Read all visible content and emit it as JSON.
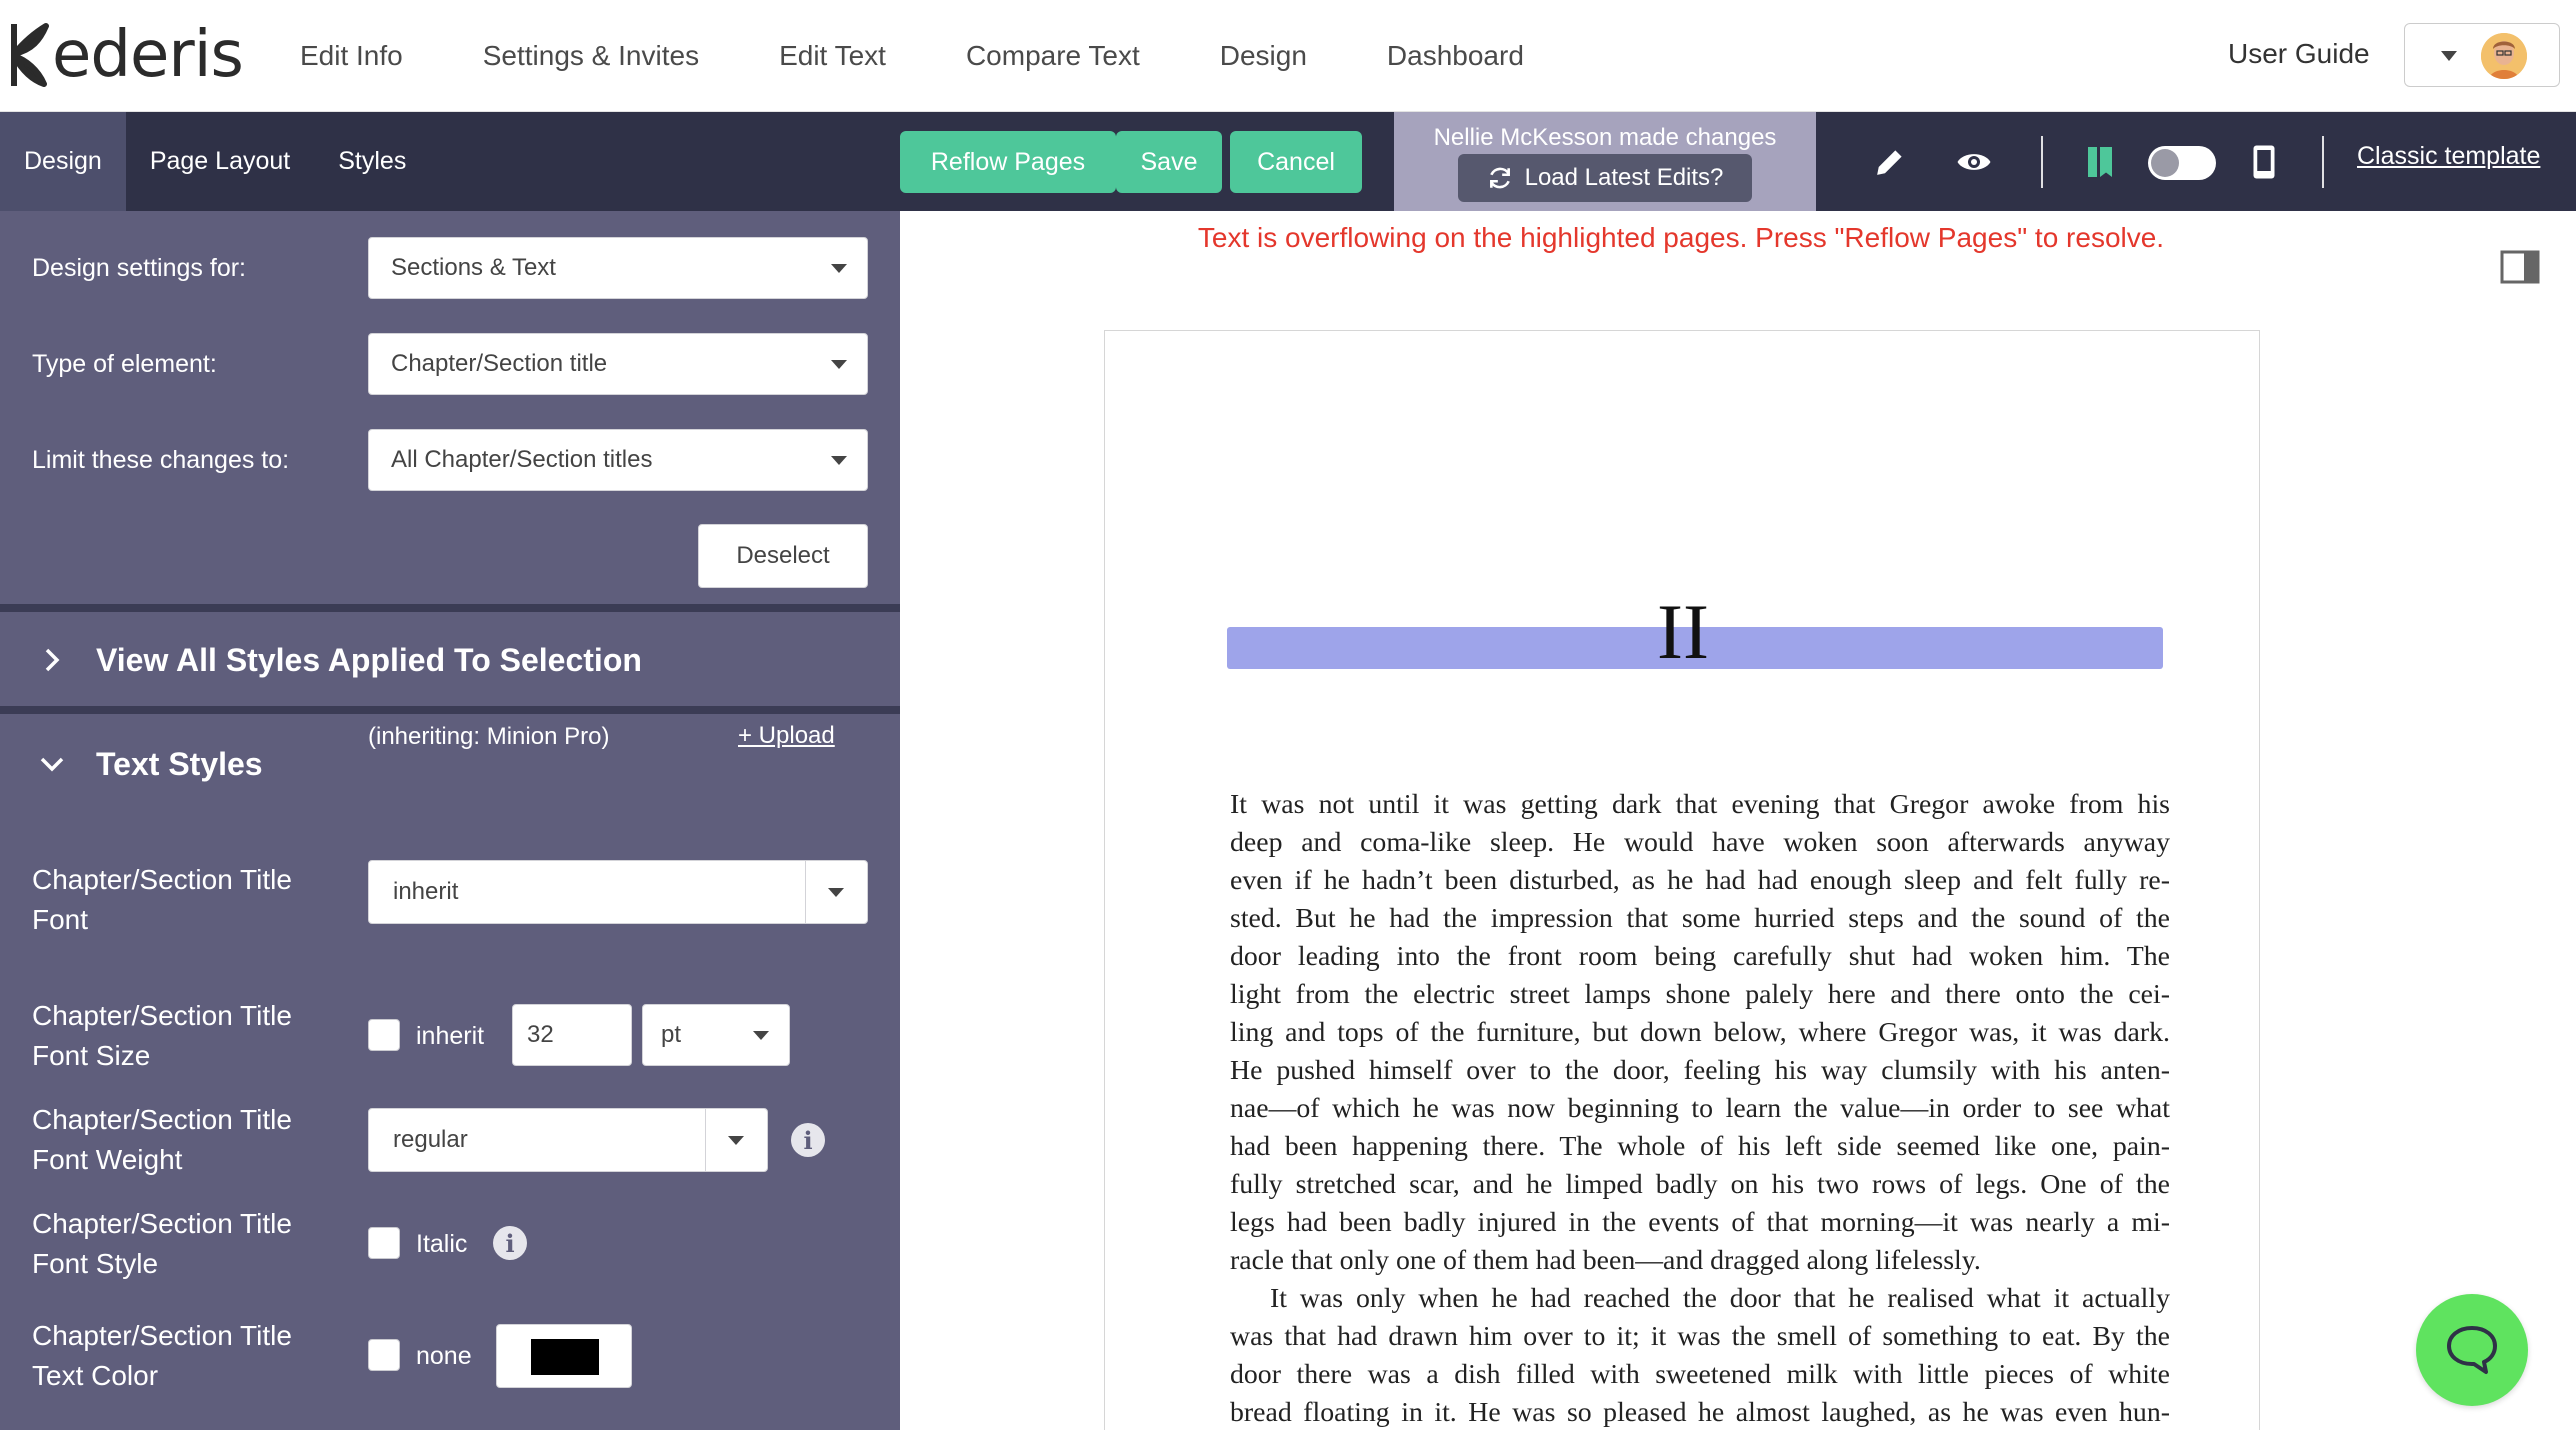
{
  "brand": {
    "name": "ederis"
  },
  "nav": {
    "links": [
      "Edit Info",
      "Settings & Invites",
      "Edit Text",
      "Compare Text",
      "Design",
      "Dashboard"
    ],
    "user_guide": "User Guide"
  },
  "toolbar": {
    "tabs": [
      "Design",
      "Page Layout",
      "Styles"
    ],
    "active_tab": "Design",
    "reflow_label": "Reflow Pages",
    "save_label": "Save",
    "cancel_label": "Cancel",
    "notice": "Nellie McKesson made changes",
    "load_edits_label": "Load Latest Edits?",
    "template_link": "Classic template",
    "accent_color": "#4ec79a",
    "bar_color": "#2f3147"
  },
  "panel": {
    "design_settings_label": "Design settings for:",
    "design_settings_value": "Sections & Text",
    "element_type_label": "Type of element:",
    "element_type_value": "Chapter/Section title",
    "limit_label": "Limit these changes to:",
    "limit_value": "All Chapter/Section titles",
    "deselect_label": "Deselect",
    "view_all_styles": "View All Styles Applied To Selection",
    "text_styles": "Text Styles",
    "font_label": "Chapter/Section Title Font",
    "font_value": "inherit",
    "font_hint": "(inheriting: Minion Pro)",
    "upload_label": "+ Upload",
    "size_label": "Chapter/Section Title Font Size",
    "size_inherit": "inherit",
    "size_value": "32",
    "size_unit": "pt",
    "weight_label": "Chapter/Section Title Font Weight",
    "weight_value": "regular",
    "style_label": "Chapter/Section Title Font Style",
    "style_italic": "Italic",
    "color_label": "Chapter/Section Title Text Color",
    "color_none": "none",
    "text_color": "#000000",
    "panel_color": "#5f5e7c"
  },
  "preview": {
    "overflow_message": "Text is overflowing on the highlighted pages. Press \"Reflow Pages\" to resolve.",
    "chapter_title": "II",
    "highlight_color": "#9ea4ea",
    "lines": [
      "It was not until it was getting dark that evening that Gregor awoke from his",
      "deep and coma-like sleep. He would have woken soon afterwards anyway",
      "even if he hadn’t been disturbed, as he had had enough sleep and felt fully re-",
      "sted. But he had the impression that some hurried steps and the sound of the",
      "door leading into the front room being carefully shut had woken him. The",
      "light from the electric street lamps shone palely here and there onto the cei-",
      "ling and tops of the furniture, but down below, where Gregor was, it was dark.",
      "He pushed himself over to the door, feeling his way clumsily with his anten-",
      "nae—of which he was now beginning to learn the value—in order to see what",
      "had been happening there. The whole of his left side seemed like one, pain-",
      "fully stretched scar, and he limped badly on his two rows of legs. One of the",
      "legs had been badly injured in the events of that morning—it was nearly a mi-",
      "racle that only one of them had been—and dragged along lifelessly.",
      "It was only when he had reached the door that he realised what it actually",
      "was that had drawn him over to it; it was the smell of something to eat. By the",
      "door there was a dish filled with sweetened milk with little pieces of white",
      "bread floating in it. He was so pleased he almost laughed, as he was even hun-"
    ]
  },
  "chat": {
    "icon": "chat-bubble-icon",
    "color": "#5fe35f"
  }
}
